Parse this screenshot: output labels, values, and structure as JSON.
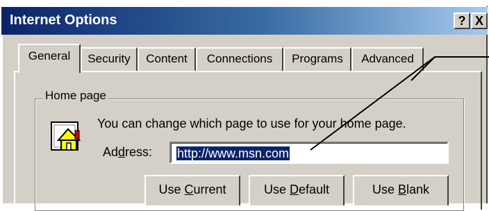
{
  "window": {
    "title": "Internet Options",
    "help_label": "?",
    "close_label": "X"
  },
  "tabs": [
    {
      "label": "General",
      "active": true
    },
    {
      "label": "Security"
    },
    {
      "label": "Content"
    },
    {
      "label": "Connections"
    },
    {
      "label": "Programs"
    },
    {
      "label": "Advanced"
    }
  ],
  "home_page": {
    "group_label": "Home page",
    "description": "You can change which page to use for your home page.",
    "address_label": {
      "pre": "Ad",
      "accel": "d",
      "post": "ress:"
    },
    "address_value": "http://www.msn.com",
    "buttons": {
      "use_current": {
        "pre": "Use ",
        "accel": "C",
        "post": "urrent"
      },
      "use_default": {
        "pre": "Use ",
        "accel": "D",
        "post": "efault"
      },
      "use_blank": {
        "pre": "Use ",
        "accel": "B",
        "post": "lank"
      }
    }
  },
  "icons": [
    "house-icon"
  ],
  "colors": {
    "title_gradient_start": "#0a246a",
    "title_gradient_end": "#a6caf0",
    "dialog_face": "#d4d0c8",
    "selection": "#0a246a"
  }
}
